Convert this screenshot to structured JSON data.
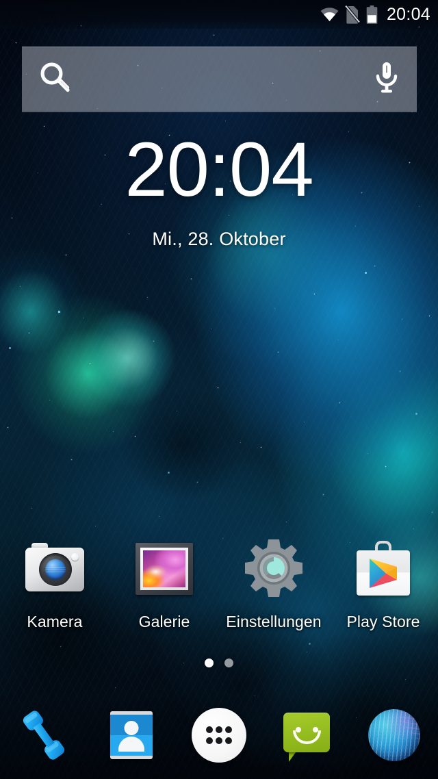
{
  "status_bar": {
    "time": "20:04",
    "icons": [
      {
        "name": "wifi-icon",
        "label": "WiFi connected"
      },
      {
        "name": "no-sim-icon",
        "label": "No SIM card"
      },
      {
        "name": "battery-icon",
        "label": "Battery 50 percent",
        "level_percent": 50
      }
    ]
  },
  "search_widget": {
    "placeholder": "",
    "value": "",
    "search_icon": "magnifier-icon",
    "voice_icon": "microphone-icon"
  },
  "clock_widget": {
    "time": "20:04",
    "date": "Mi., 28. Oktober"
  },
  "app_grid": {
    "apps": [
      {
        "label": "Kamera",
        "icon": "camera-icon"
      },
      {
        "label": "Galerie",
        "icon": "gallery-icon"
      },
      {
        "label": "Einstellungen",
        "icon": "settings-gear-icon"
      },
      {
        "label": "Play Store",
        "icon": "play-store-icon"
      }
    ]
  },
  "page_indicator": {
    "count": 2,
    "active_index": 0,
    "dots": [
      {
        "state": "active"
      },
      {
        "state": "inactive"
      }
    ]
  },
  "dock": {
    "items": [
      {
        "label": "Telefon",
        "icon": "phone-handset-icon"
      },
      {
        "label": "Kontakte",
        "icon": "contacts-card-icon"
      },
      {
        "label": "Apps",
        "icon": "app-drawer-icon"
      },
      {
        "label": "Messaging",
        "icon": "message-bubble-icon"
      },
      {
        "label": "Browser",
        "icon": "globe-browser-icon"
      }
    ]
  },
  "colors": {
    "status_text": "#ffffff",
    "clock_text": "#ffffff",
    "label_text": "#ffffff",
    "search_bar_bg": "#b6bac4",
    "settings_accent": "#9fe8dd",
    "messaging_green": "#9dc426",
    "contacts_blue": "#1b88d0",
    "phone_blue": "#1fa6ef",
    "wallpaper_deep": "#03060f",
    "wallpaper_nebula": "#1596d2"
  }
}
